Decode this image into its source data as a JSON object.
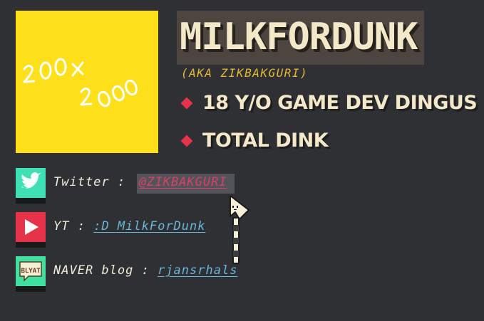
{
  "profile": {
    "avatar_caption_line1": "200x",
    "avatar_caption_line2": "200",
    "name": "MILKFORDUNK",
    "aka": "(AKA ZIKBAKGURI)",
    "bullets": [
      "18 Y/O GAME DEV DINGUS",
      "TOTAL DINK"
    ]
  },
  "links": [
    {
      "label": "Twitter :",
      "link_text": "@ZIKBAKGURI",
      "icon": "twitter-bird-icon",
      "state": "hover"
    },
    {
      "label": "YT :",
      "link_text": ":D MilkForDunk",
      "icon": "youtube-play-icon"
    },
    {
      "label": "NAVER blog :",
      "link_text": "rjansrhals",
      "icon": "blyat-blog-icon",
      "icon_text": "BLYAT"
    }
  ],
  "colors": {
    "background": "#2f3033",
    "avatar": "#fde01a",
    "title_text": "#f3e8c8",
    "title_box": "#4d4640",
    "aka": "#e7b832",
    "bullet_diamond": "#e6334a",
    "link": "#69b7d8",
    "link_hover": "#dc3f63",
    "twitter_icon_bg": "#3fe0b6",
    "youtube_icon_bg": "#e6334a",
    "blog_icon_bg": "#3fe0a0"
  }
}
